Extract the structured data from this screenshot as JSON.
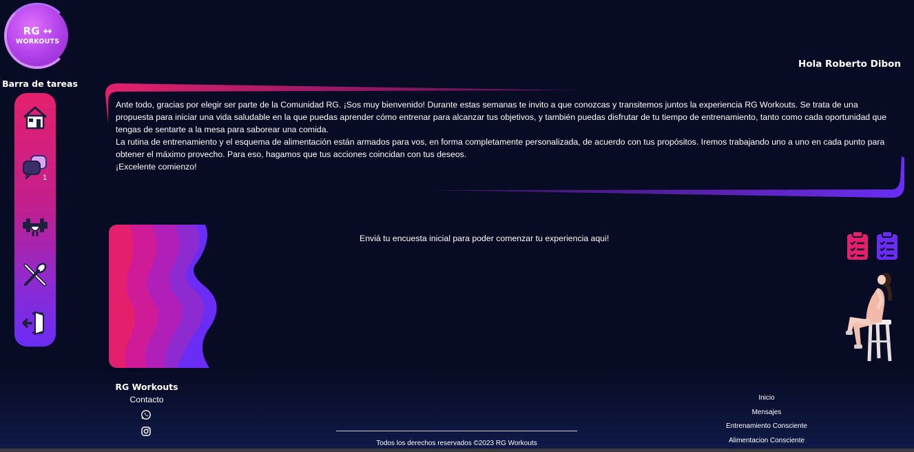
{
  "logo": {
    "line1": "RG",
    "arrows": "↔",
    "line2": "WORKOUTS"
  },
  "sidebar": {
    "title": "Barra de tareas",
    "items": [
      {
        "name": "home-icon"
      },
      {
        "name": "chat-icon",
        "badge": "1"
      },
      {
        "name": "dumbbell-icon"
      },
      {
        "name": "utensils-icon"
      },
      {
        "name": "logout-icon"
      }
    ]
  },
  "header": {
    "greeting": "Hola Roberto Dibon"
  },
  "welcome": {
    "p1": "Ante todo, gracias por elegir ser parte de la Comunidad RG. ¡Sos muy bienvenido! Durante estas semanas te invito a que conozcas y transitemos juntos la experiencia RG Workouts. Se trata de una propuesta para iniciar una vida saludable en la que puedas aprender cómo entrenar para alcanzar tus objetivos, y también puedas disfrutar de tu tiempo de entrenamiento, tanto como cada oportunidad que tengas de sentarte a la mesa para saborear una comida.",
    "p2": "La rutina de entrenamiento y el esquema de alimentación están armados para vos, en forma completamente personalizada, de acuerdo con tus propósitos. Iremos trabajando uno a uno en cada punto para obtener el máximo provecho. Para eso, hagamos que tus acciones coincidan con tus deseos.",
    "p3": "¡Excelente comienzo!"
  },
  "survey": {
    "text": "Enviá tu encuesta inicial para poder comenzar tu experiencia aqui!"
  },
  "colors": {
    "pink": "#e4206c",
    "purple": "#6a2df5",
    "background": "#080b24"
  },
  "footer": {
    "brand": "RG Workouts",
    "contact": "Contacto",
    "copyright": "Todos los derechos reservados ©2023 RG Workouts",
    "links": [
      "Inicio",
      "Mensajes",
      "Entrenamiento Consciente",
      "Alimentacion Consciente"
    ]
  }
}
